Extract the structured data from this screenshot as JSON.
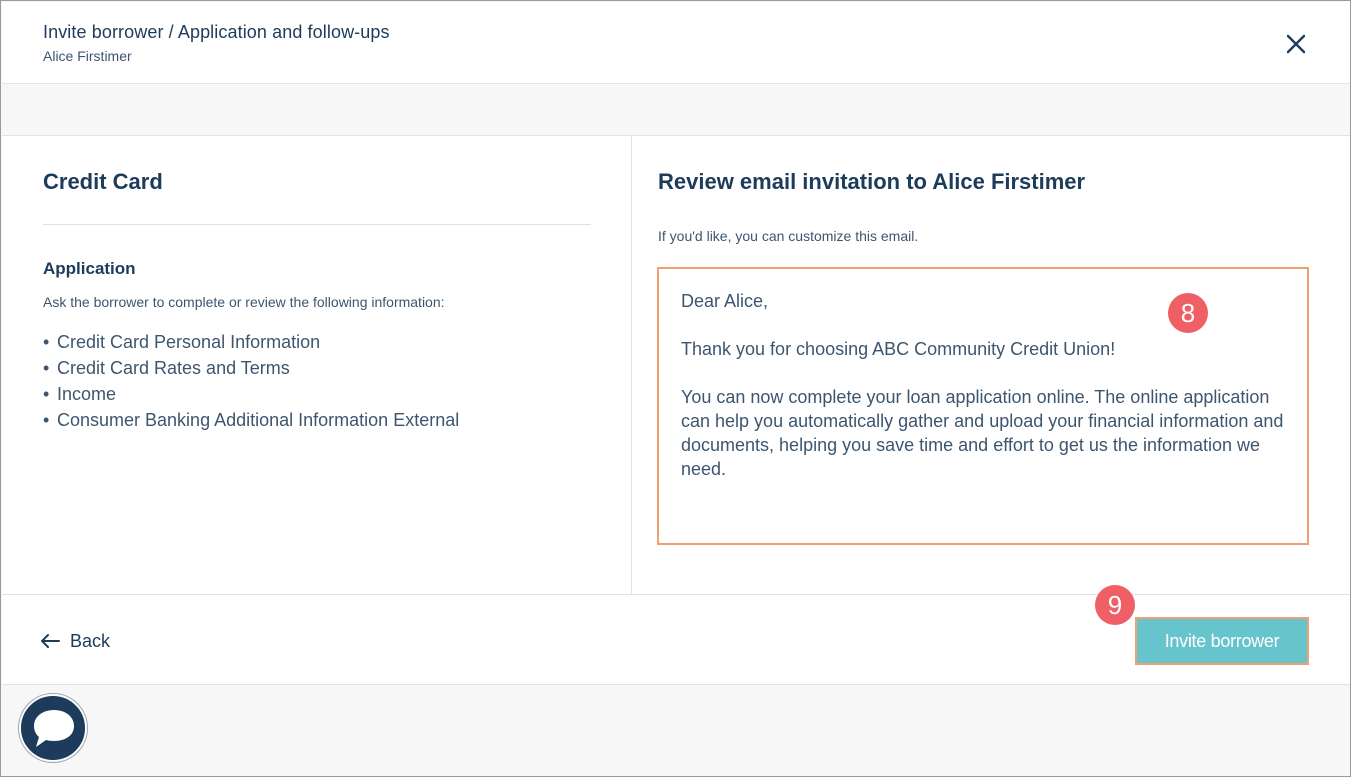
{
  "header": {
    "title": "Invite borrower / Application and follow-ups",
    "subtitle": "Alice Firstimer"
  },
  "left": {
    "product_title": "Credit Card",
    "section_title": "Application",
    "description": "Ask the borrower to complete or review the following information:",
    "items": [
      "Credit Card Personal Information",
      "Credit Card Rates and Terms",
      "Income",
      "Consumer Banking Additional Information External"
    ]
  },
  "right": {
    "title": "Review email invitation to Alice Firstimer",
    "hint": "If you'd like, you can customize this email.",
    "email": {
      "greeting": "Dear Alice,",
      "para1": "Thank you for choosing ABC Community Credit Union!",
      "para2": "You can now complete your loan application online. The online application can help you automatically gather and upload your financial information and documents, helping you save time and effort to get us the information we need."
    }
  },
  "footer": {
    "back_label": "Back",
    "invite_label": "Invite borrower"
  },
  "annotations": {
    "badge_email": "8",
    "badge_invite": "9"
  },
  "colors": {
    "primary_text": "#1d3b5a",
    "accent_button": "#66c4cc",
    "highlight_border": "#f0a073",
    "badge": "#ee5f66"
  },
  "icons": {
    "close": "close-icon",
    "back": "arrow-left-icon",
    "chat": "chat-bubble-icon"
  }
}
